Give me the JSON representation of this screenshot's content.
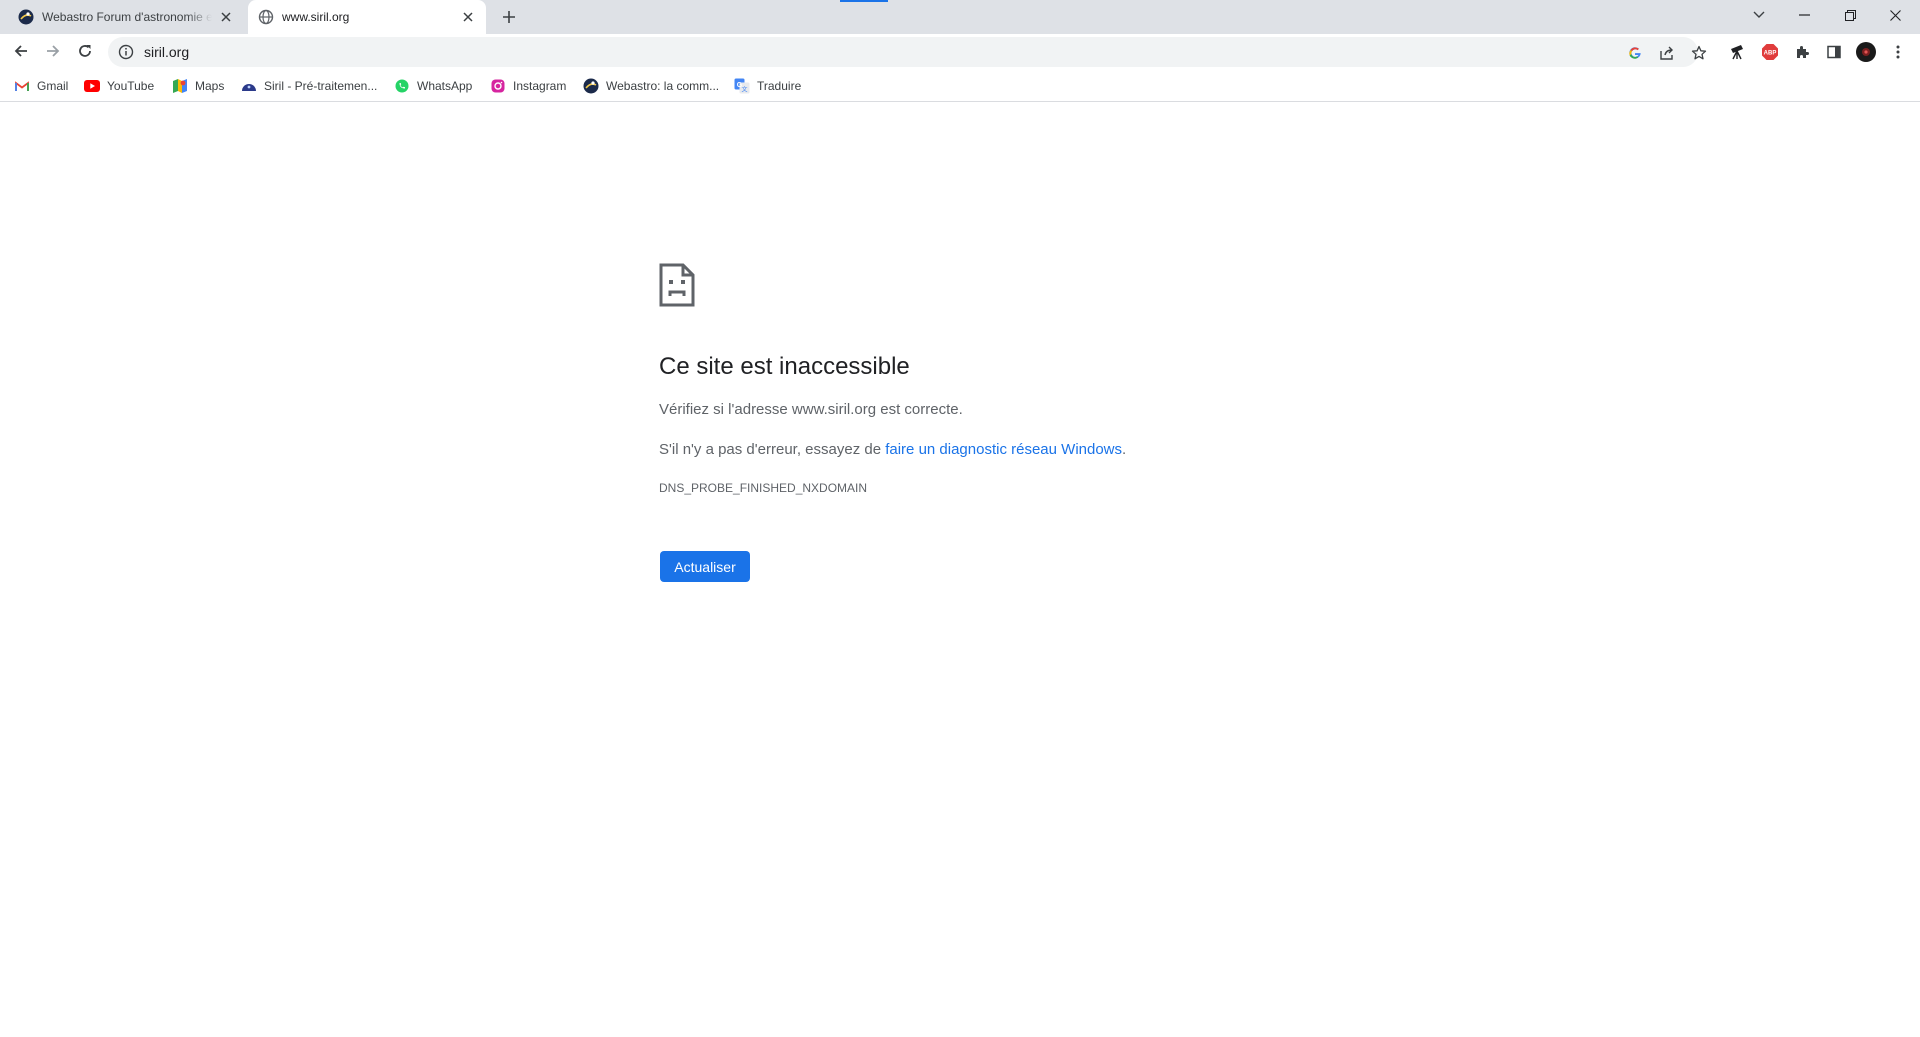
{
  "tabs": [
    {
      "title": "Webastro Forum d'astronomie et",
      "active": false
    },
    {
      "title": "www.siril.org",
      "active": true
    }
  ],
  "omnibox": {
    "url": "siril.org"
  },
  "bookmarks": [
    {
      "label": "Gmail",
      "icon": "gmail-icon"
    },
    {
      "label": "YouTube",
      "icon": "youtube-icon"
    },
    {
      "label": "Maps",
      "icon": "maps-icon"
    },
    {
      "label": "Siril - Pré-traitemen...",
      "icon": "siril-icon"
    },
    {
      "label": "WhatsApp",
      "icon": "whatsapp-icon"
    },
    {
      "label": "Instagram",
      "icon": "instagram-icon"
    },
    {
      "label": "Webastro: la comm...",
      "icon": "webastro-icon"
    },
    {
      "label": "Traduire",
      "icon": "translate-icon"
    }
  ],
  "error": {
    "title": "Ce site est inaccessible",
    "line1": "Vérifiez si l'adresse www.siril.org est correcte.",
    "line2_prefix": "S'il n'y a pas d'erreur, essayez de ",
    "line2_link": "faire un diagnostic réseau Windows",
    "line2_suffix": ".",
    "code": "DNS_PROBE_FINISHED_NXDOMAIN",
    "button": "Actualiser"
  },
  "colors": {
    "accent": "#1a73e8",
    "tabstrip": "#dee1e6",
    "omnibox": "#f1f3f4",
    "text_secondary": "#5f6368"
  }
}
